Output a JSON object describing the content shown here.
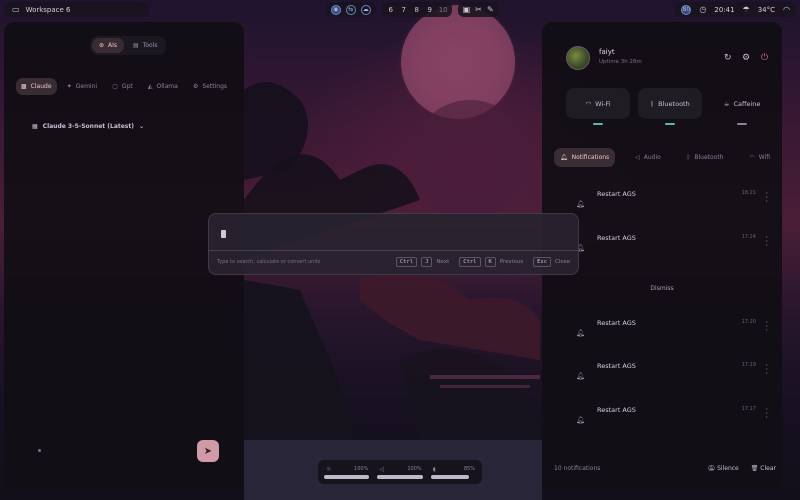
{
  "topbar": {
    "workspace_label": "Workspace 6",
    "workspaces": [
      "6",
      "7",
      "8",
      "9",
      "10"
    ],
    "badge": "80",
    "time": "20:41",
    "temperature": "34°C"
  },
  "ai_panel": {
    "top_tabs": [
      {
        "label": "AIs",
        "icon": "robot-icon"
      },
      {
        "label": "Tools",
        "icon": "briefcase-icon"
      }
    ],
    "model_tabs": [
      {
        "label": "Claude",
        "icon": "claude-icon"
      },
      {
        "label": "Gemini",
        "icon": "sparkle-icon"
      },
      {
        "label": "Gpt",
        "icon": "chat-icon"
      },
      {
        "label": "Ollama",
        "icon": "ollama-icon"
      },
      {
        "label": "Settings",
        "icon": "gear-icon"
      }
    ],
    "model_select": "Claude 3-5-Sonnet (Latest)"
  },
  "sidebar_right": {
    "user": {
      "name": "faiyt",
      "uptime": "Uptime 3h 28m"
    },
    "toggles": [
      {
        "label": "Wi-Fi",
        "icon": "wifi-icon",
        "state": "on"
      },
      {
        "label": "Bluetooth",
        "icon": "bluetooth-icon",
        "state": "on"
      },
      {
        "label": "Caffeine",
        "icon": "coffee-icon",
        "state": "off"
      }
    ],
    "tabs": [
      {
        "label": "Notifications",
        "icon": "bell-icon"
      },
      {
        "label": "Audio",
        "icon": "speaker-icon"
      },
      {
        "label": "Bluetooth",
        "icon": "bluetooth-icon"
      },
      {
        "label": "Wifi",
        "icon": "wifi-icon"
      }
    ],
    "notifications_group1": [
      {
        "title": "Restart AGS",
        "time": "18:21"
      },
      {
        "title": "Restart AGS",
        "time": "17:24"
      }
    ],
    "dismiss_label": "Dismiss",
    "notifications_group2": [
      {
        "title": "Restart AGS",
        "time": "17:20"
      },
      {
        "title": "Restart AGS",
        "time": "17:19"
      },
      {
        "title": "Restart AGS",
        "time": "17:17"
      }
    ],
    "footer": {
      "count": "10 notifications",
      "silence": "Silence",
      "clear": "Clear"
    }
  },
  "search": {
    "placeholder": "Type to search, calculate or convert units",
    "shortcuts": [
      {
        "keys": [
          "Ctrl",
          "J"
        ],
        "label": "Next"
      },
      {
        "keys": [
          "Ctrl",
          "K"
        ],
        "label": "Previous"
      },
      {
        "keys": [
          "Esc"
        ],
        "label": "Close"
      }
    ]
  },
  "sliders": [
    {
      "icon": "brightness-icon",
      "value": "100%",
      "level": 1.0
    },
    {
      "icon": "volume-icon",
      "value": "100%",
      "level": 1.0
    },
    {
      "icon": "mic-icon",
      "value": "85%",
      "level": 0.85
    }
  ]
}
